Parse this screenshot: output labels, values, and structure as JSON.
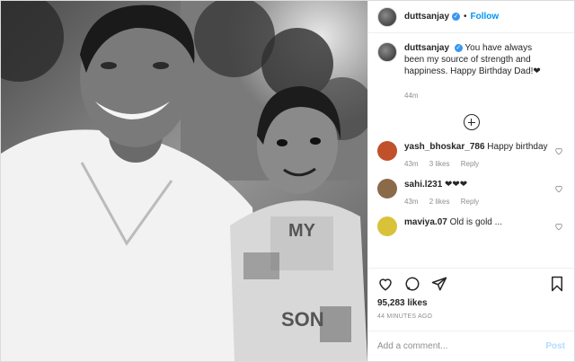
{
  "post": {
    "username": "duttsanjay",
    "follow_label": "Follow",
    "separator": "•",
    "caption": "You have always been my source of strength and happiness. Happy Birthday Dad!",
    "caption_heart": "❤",
    "caption_time": "44m",
    "photo": {
      "shirt_text_top": "MY",
      "shirt_text_bottom": "SON"
    }
  },
  "comments": [
    {
      "username": "yash_bhoskar_786",
      "text": "Happy birthday",
      "time": "43m",
      "likes": "3 likes",
      "reply": "Reply",
      "avatar_color": "#c0512a"
    },
    {
      "username": "sahi.l231",
      "text": "❤❤❤",
      "time": "43m",
      "likes": "2 likes",
      "reply": "Reply",
      "avatar_color": "#8b6a4a"
    },
    {
      "username": "maviya.07",
      "text": "Old is gold ...",
      "time": "",
      "likes": "",
      "reply": "",
      "avatar_color": "#d9c23a"
    }
  ],
  "actions": {
    "likes": "95,283 likes",
    "time_ago": "44 MINUTES AGO"
  },
  "composer": {
    "placeholder": "Add a comment...",
    "post_label": "Post"
  },
  "icons": [
    "heart-icon",
    "comment-icon",
    "share-icon",
    "bookmark-icon",
    "plus-circle-icon",
    "verified-icon"
  ]
}
